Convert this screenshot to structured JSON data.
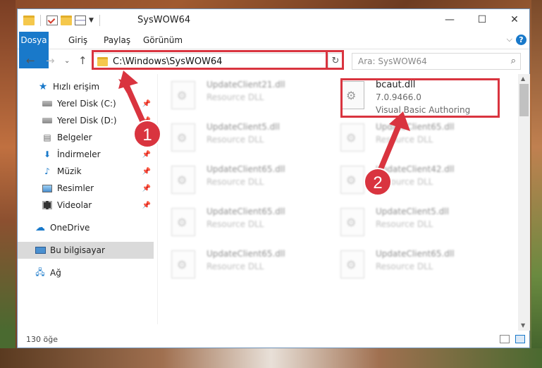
{
  "window": {
    "title": "SysWOW64",
    "controls": {
      "minimize": "—",
      "maximize": "☐",
      "close": "✕"
    }
  },
  "ribbon": {
    "tabs": [
      "Dosya",
      "Giriş",
      "Paylaş",
      "Görünüm"
    ],
    "help": "?"
  },
  "navigation": {
    "address": "C:\\Windows\\SysWOW64",
    "search_placeholder": "Ara: SysWOW64"
  },
  "sidebar": {
    "items": [
      {
        "label": "Hızlı erişim",
        "icon": "star-icon"
      },
      {
        "label": "Yerel Disk (C:)",
        "icon": "drive-icon",
        "pinned": true
      },
      {
        "label": "Yerel Disk (D:)",
        "icon": "drive-icon",
        "pinned": true
      },
      {
        "label": "Belgeler",
        "icon": "documents-icon",
        "pinned": true
      },
      {
        "label": "İndirmeler",
        "icon": "download-icon",
        "pinned": true
      },
      {
        "label": "Müzik",
        "icon": "music-icon",
        "pinned": true
      },
      {
        "label": "Resimler",
        "icon": "pictures-icon",
        "pinned": true
      },
      {
        "label": "Videolar",
        "icon": "videos-icon",
        "pinned": true
      },
      {
        "label": "OneDrive",
        "icon": "cloud-icon"
      },
      {
        "label": "Bu bilgisayar",
        "icon": "computer-icon",
        "selected": true
      },
      {
        "label": "Ağ",
        "icon": "network-icon"
      }
    ]
  },
  "files": {
    "highlighted": {
      "name": "bcaut.dll",
      "version": "7.0.9466.0",
      "description": "Visual Basic Authoring"
    },
    "left_column": [
      {
        "name": "UpdateClient21.dll",
        "type": "Resource DLL"
      },
      {
        "name": "UpdateClient5.dll",
        "type": "Resource DLL"
      },
      {
        "name": "UpdateClient65.dll",
        "type": "Resource DLL"
      },
      {
        "name": "UpdateClient65.dll",
        "type": "Resource DLL"
      },
      {
        "name": "UpdateClient65.dll",
        "type": "Resource DLL"
      }
    ],
    "right_column": [
      {
        "name": "UpdateClient65.dll",
        "type": "Resource DLL"
      },
      {
        "name": "UpdateClient42.dll",
        "type": "Resource DLL"
      },
      {
        "name": "UpdateClient5.dll",
        "type": "Resource DLL"
      },
      {
        "name": "UpdateClient65.dll",
        "type": "Resource DLL"
      }
    ]
  },
  "status": {
    "count": "130 öğe"
  },
  "annotations": {
    "step1": "1",
    "step2": "2",
    "color": "#d9343f"
  }
}
